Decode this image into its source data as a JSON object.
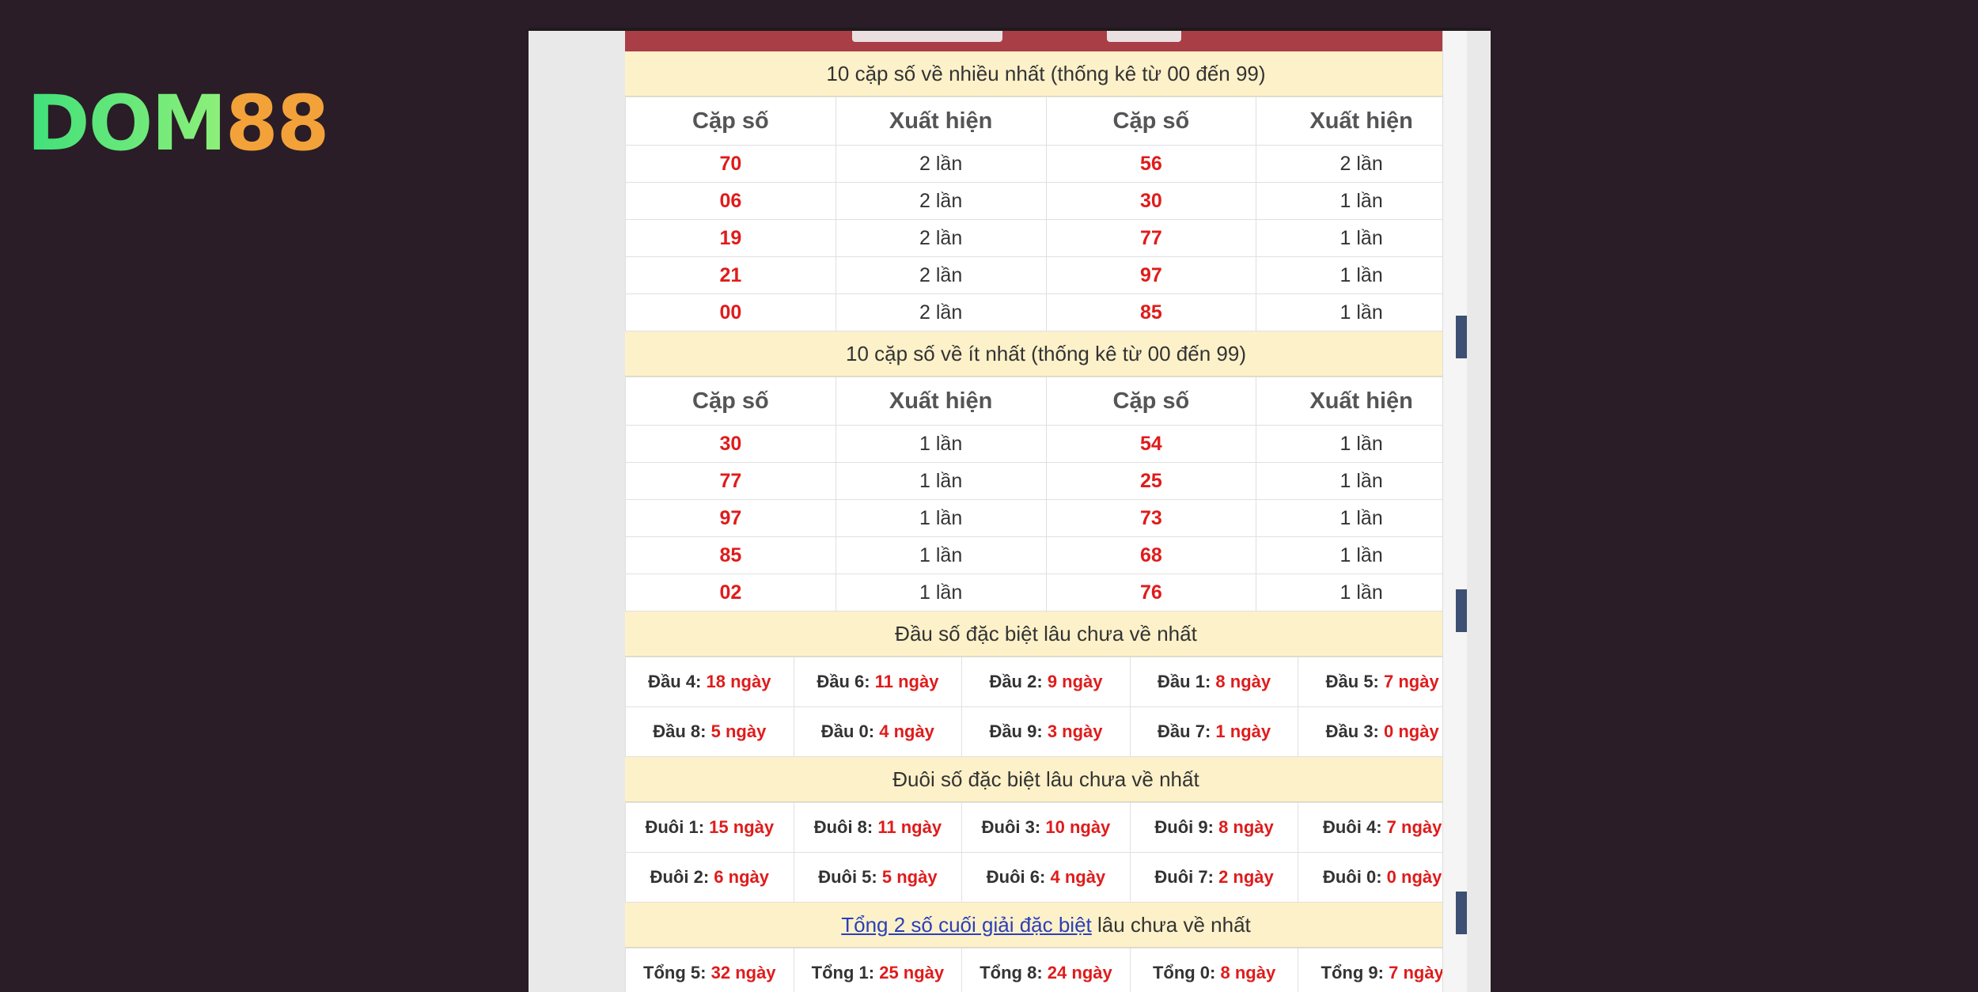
{
  "brand": {
    "logo_left": "DOM",
    "logo_right": "88"
  },
  "most": {
    "title": "10 cặp số về nhiều nhất (thống kê từ 00 đến 99)",
    "headers": [
      "Cặp số",
      "Xuất hiện",
      "Cặp số",
      "Xuất hiện"
    ],
    "rows": [
      [
        "70",
        "2 lần",
        "56",
        "2 lần"
      ],
      [
        "06",
        "2 lần",
        "30",
        "1 lần"
      ],
      [
        "19",
        "2 lần",
        "77",
        "1 lần"
      ],
      [
        "21",
        "2 lần",
        "97",
        "1 lần"
      ],
      [
        "00",
        "2 lần",
        "85",
        "1 lần"
      ]
    ]
  },
  "least": {
    "title": "10 cặp số về ít nhất (thống kê từ 00 đến 99)",
    "headers": [
      "Cặp số",
      "Xuất hiện",
      "Cặp số",
      "Xuất hiện"
    ],
    "rows": [
      [
        "30",
        "1 lần",
        "54",
        "1 lần"
      ],
      [
        "77",
        "1 lần",
        "25",
        "1 lần"
      ],
      [
        "97",
        "1 lần",
        "73",
        "1 lần"
      ],
      [
        "85",
        "1 lần",
        "68",
        "1 lần"
      ],
      [
        "02",
        "1 lần",
        "76",
        "1 lần"
      ]
    ]
  },
  "head": {
    "title": "Đầu số đặc biệt lâu chưa về nhất",
    "rows": [
      [
        [
          "Đầu 4:",
          "18 ngày"
        ],
        [
          "Đầu 6:",
          "11 ngày"
        ],
        [
          "Đầu 2:",
          "9 ngày"
        ],
        [
          "Đầu 1:",
          "8 ngày"
        ],
        [
          "Đầu 5:",
          "7 ngày"
        ]
      ],
      [
        [
          "Đầu 8:",
          "5 ngày"
        ],
        [
          "Đầu 0:",
          "4 ngày"
        ],
        [
          "Đầu 9:",
          "3 ngày"
        ],
        [
          "Đầu 7:",
          "1 ngày"
        ],
        [
          "Đầu 3:",
          "0 ngày"
        ]
      ]
    ]
  },
  "tail": {
    "title": "Đuôi số đặc biệt lâu chưa về nhất",
    "rows": [
      [
        [
          "Đuôi 1:",
          "15 ngày"
        ],
        [
          "Đuôi 8:",
          "11 ngày"
        ],
        [
          "Đuôi 3:",
          "10 ngày"
        ],
        [
          "Đuôi 9:",
          "8 ngày"
        ],
        [
          "Đuôi 4:",
          "7 ngày"
        ]
      ],
      [
        [
          "Đuôi 2:",
          "6 ngày"
        ],
        [
          "Đuôi 5:",
          "5 ngày"
        ],
        [
          "Đuôi 6:",
          "4 ngày"
        ],
        [
          "Đuôi 7:",
          "2 ngày"
        ],
        [
          "Đuôi 0:",
          "0 ngày"
        ]
      ]
    ]
  },
  "sum": {
    "title_link": "Tổng 2 số cuối giải đặc biệt",
    "title_rest": " lâu chưa về nhất",
    "rows": [
      [
        [
          "Tổng 5:",
          "32 ngày"
        ],
        [
          "Tổng 1:",
          "25 ngày"
        ],
        [
          "Tổng 8:",
          "24 ngày"
        ],
        [
          "Tổng 0:",
          "8 ngày"
        ],
        [
          "Tổng 9:",
          "7 ngày"
        ]
      ]
    ]
  }
}
